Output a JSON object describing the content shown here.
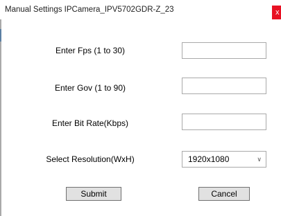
{
  "window": {
    "title": "Manual Settings IPCamera_IPV5702GDR-Z_23",
    "close_glyph": "x"
  },
  "form": {
    "fps": {
      "label": "Enter Fps (1 to 30)",
      "value": ""
    },
    "gov": {
      "label": "Enter Gov (1 to 90)",
      "value": ""
    },
    "bitrate": {
      "label": "Enter Bit Rate(Kbps)",
      "value": ""
    },
    "resolution": {
      "label": "Select Resolution(WxH)",
      "selected": "1920x1080",
      "arrow_icon": "chevron-down-icon"
    }
  },
  "buttons": {
    "submit": "Submit",
    "cancel": "Cancel"
  }
}
